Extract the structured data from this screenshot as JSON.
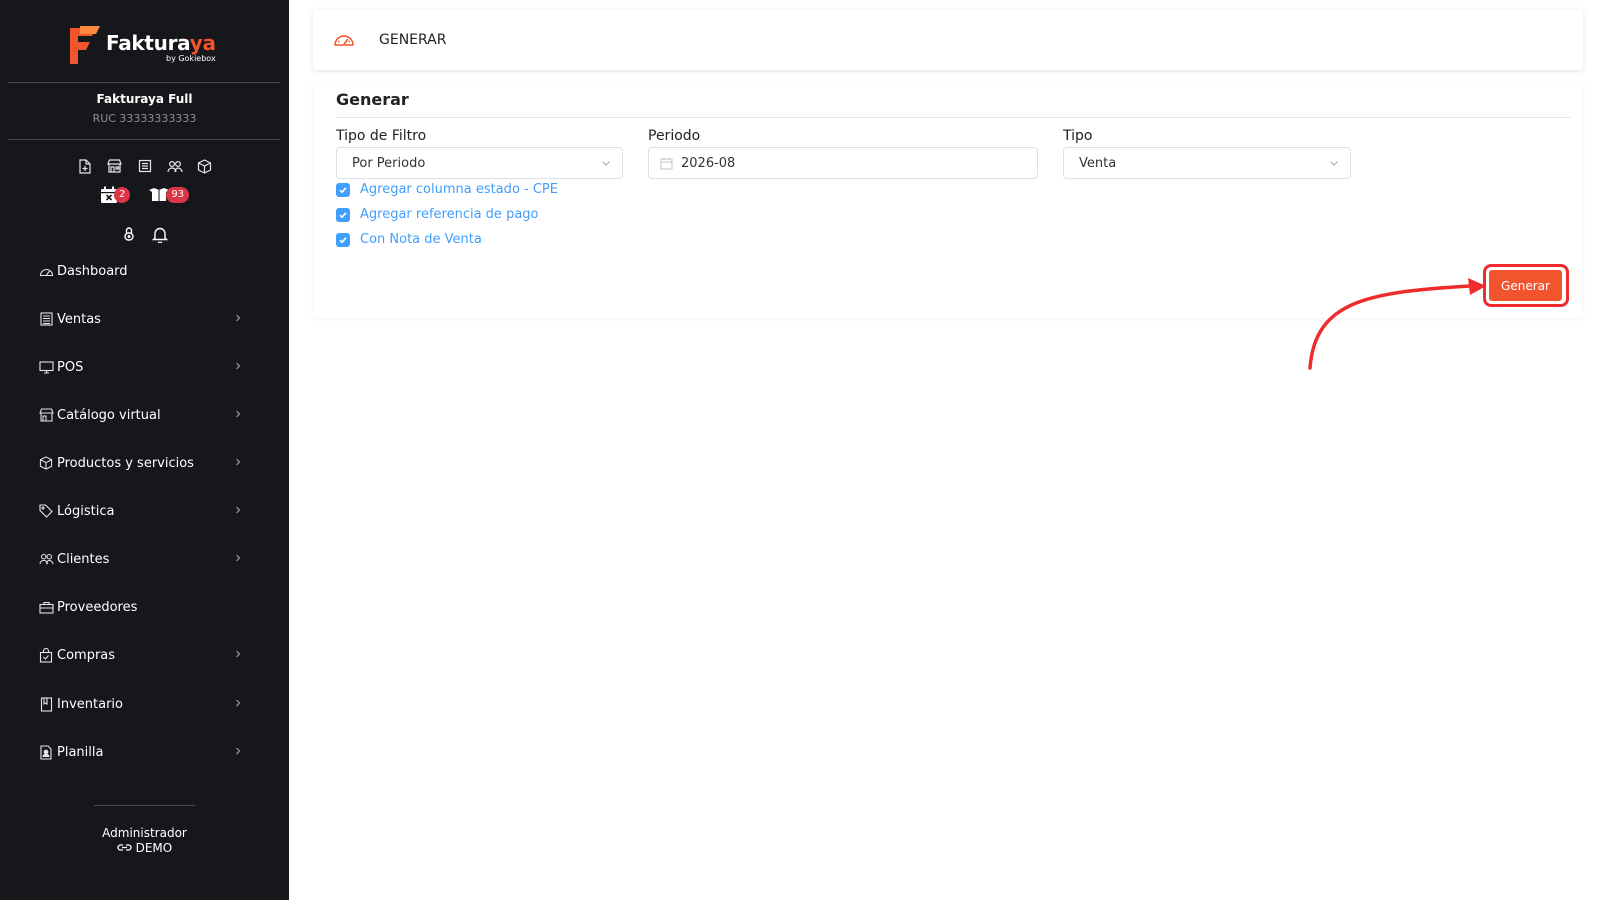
{
  "brand": {
    "name_main": "Faktura",
    "name_accent": "ya",
    "byline": "by Gokiebox"
  },
  "company": {
    "name": "Fakturaya Full",
    "ruc": "RUC 33333333333"
  },
  "quick_icons": [
    "new-document-icon",
    "store-icon",
    "receipt-list-icon",
    "users-icon",
    "box-icon"
  ],
  "badges": [
    {
      "icon": "calendar-x-icon",
      "count": "2"
    },
    {
      "icon": "boxes-icon",
      "count": "93"
    }
  ],
  "utility_icons": [
    "lock-icon",
    "bell-icon"
  ],
  "menu": [
    {
      "label": "Dashboard",
      "icon": "speedometer-icon",
      "has_children": false
    },
    {
      "label": "Ventas",
      "icon": "receipt-icon",
      "has_children": true
    },
    {
      "label": "POS",
      "icon": "monitor-icon",
      "has_children": true
    },
    {
      "label": "Catálogo virtual",
      "icon": "store-icon",
      "has_children": true
    },
    {
      "label": "Productos y servicios",
      "icon": "box-icon",
      "has_children": true
    },
    {
      "label": "Lógistica",
      "icon": "tag-icon",
      "has_children": true
    },
    {
      "label": "Clientes",
      "icon": "users-icon",
      "has_children": true
    },
    {
      "label": "Proveedores",
      "icon": "briefcase-icon",
      "has_children": false
    },
    {
      "label": "Compras",
      "icon": "shopping-bag-icon",
      "has_children": true
    },
    {
      "label": "Inventario",
      "icon": "book-icon",
      "has_children": true
    },
    {
      "label": "Planilla",
      "icon": "file-person-icon",
      "has_children": true
    }
  ],
  "user": {
    "role": "Administrador",
    "name": "DEMO"
  },
  "topbar": {
    "title": "GENERAR",
    "icon": "speedometer-icon"
  },
  "form": {
    "title": "Generar",
    "tipo_filtro": {
      "label": "Tipo de Filtro",
      "value": "Por Periodo"
    },
    "periodo": {
      "label": "Periodo",
      "value": "2026-08"
    },
    "tipo": {
      "label": "Tipo",
      "value": "Venta"
    },
    "checkboxes": [
      {
        "label": "Agregar columna estado - CPE",
        "checked": true
      },
      {
        "label": "Agregar referencia de pago",
        "checked": true
      },
      {
        "label": "Con Nota de Venta",
        "checked": true
      }
    ],
    "submit_label": "Generar"
  },
  "colors": {
    "sidebar_bg": "#15171b",
    "accent": "#f2542d",
    "checkbox": "#409eff",
    "highlight": "#ef2b2b",
    "badge": "#dc3545"
  }
}
